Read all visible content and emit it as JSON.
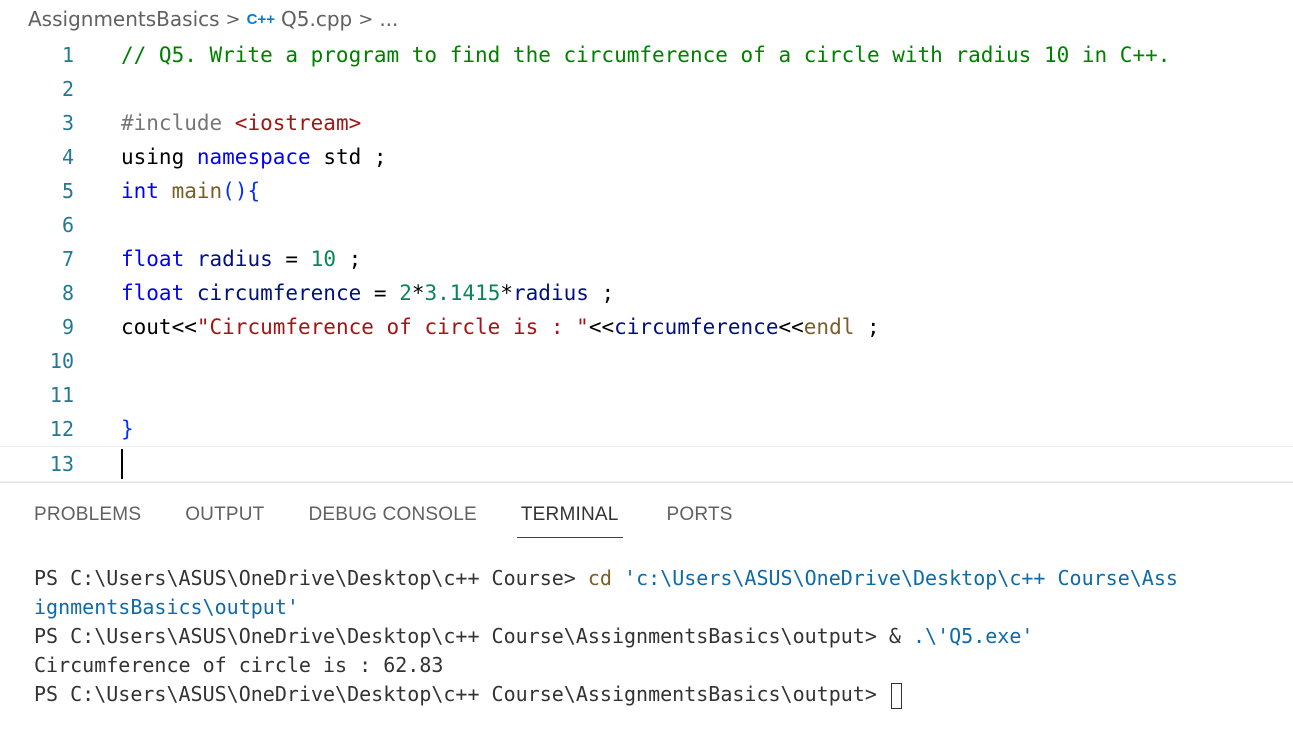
{
  "breadcrumb": {
    "folder": "AssignmentsBasics",
    "separator": ">",
    "file_icon": "C++",
    "file": "Q5.cpp",
    "more": "..."
  },
  "editor": {
    "line_numbers": [
      "1",
      "2",
      "3",
      "4",
      "5",
      "6",
      "7",
      "8",
      "9",
      "10",
      "11",
      "12",
      "13"
    ],
    "lines": {
      "l1": {
        "comment": "// Q5. Write a program to find the circumference of a circle with radius 10 in C++."
      },
      "l3": {
        "pre": "#include ",
        "header": "<iostream>"
      },
      "l4": {
        "kw": "using",
        "sp1": " ",
        "kw2": "namespace",
        "rest": " std ;"
      },
      "l5": {
        "type": "int",
        "sp": " ",
        "fn": "main",
        "paren": "()",
        "brace": "{"
      },
      "l7": {
        "type": "float",
        "sp": " ",
        "var": "radius",
        "eq": " = ",
        "num": "10",
        "end": " ;"
      },
      "l8": {
        "type": "float",
        "sp": " ",
        "var": "circumference",
        "eq": " = ",
        "num1": "2",
        "op1": "*",
        "num2": "3.1415",
        "op2": "*",
        "var2": "radius",
        "end": " ;"
      },
      "l9": {
        "cout": "cout",
        "op1": "<<",
        "str": "\"Circumference of circle is : \"",
        "op2": "<<",
        "var": "circumference",
        "op3": "<<",
        "endl": "endl",
        "end": " ;"
      },
      "l12": {
        "brace": "}"
      }
    }
  },
  "panel": {
    "tabs": [
      "PROBLEMS",
      "OUTPUT",
      "DEBUG CONSOLE",
      "TERMINAL",
      "PORTS"
    ],
    "active_tab": "TERMINAL"
  },
  "terminal": {
    "line1_prompt": "PS C:\\Users\\ASUS\\OneDrive\\Desktop\\c++ Course> ",
    "line1_cmd": "cd",
    "line1_arg": " 'c:\\Users\\ASUS\\OneDrive\\Desktop\\c++ Course\\Ass",
    "line2_arg": "ignmentsBasics\\output'",
    "line3_prompt": "PS C:\\Users\\ASUS\\OneDrive\\Desktop\\c++ Course\\AssignmentsBasics\\output> ",
    "line3_op": "& ",
    "line3_arg": ".\\'Q5.exe'",
    "line4_output": "Circumference of circle is : 62.83",
    "line5_prompt": "PS C:\\Users\\ASUS\\OneDrive\\Desktop\\c++ Course\\AssignmentsBasics\\output> "
  }
}
